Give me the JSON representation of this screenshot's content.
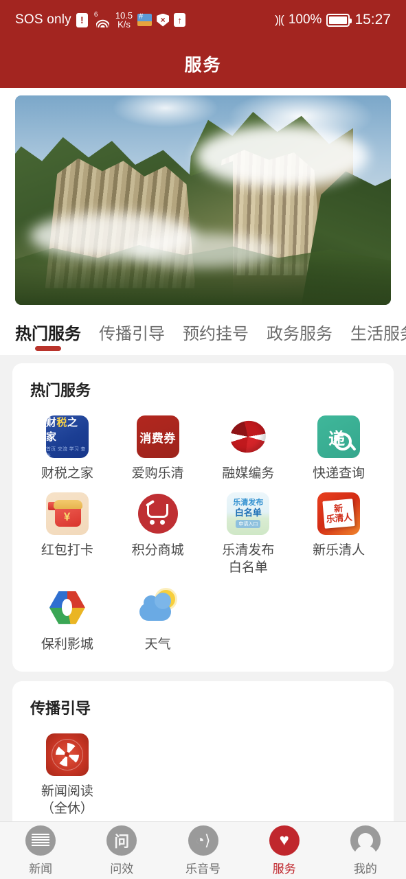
{
  "statusbar": {
    "carrier": "SOS only",
    "alert_icon": "!",
    "network_gen": "6",
    "wifi_icon": "wifi-icon",
    "speed_value": "10.5",
    "speed_unit": "K/s",
    "card_icon": "card-icon",
    "shield_icon": "×",
    "upload_icon": "↑",
    "vibrate_icon": "vibrate-icon",
    "battery_percent": "100%",
    "time": "15:27"
  },
  "header": {
    "title": "服务"
  },
  "banner": {
    "alt": "乐清山峰云雾风景横幅"
  },
  "tabs": [
    {
      "label": "热门服务",
      "active": true
    },
    {
      "label": "传播引导",
      "active": false
    },
    {
      "label": "预约挂号",
      "active": false
    },
    {
      "label": "政务服务",
      "active": false
    },
    {
      "label": "生活服务",
      "active": false
    }
  ],
  "sections": [
    {
      "title": "热门服务",
      "items": [
        {
          "name": "财税之家",
          "icon": "caishuizhijia-icon",
          "icon_text_main": "财税之家",
          "icon_text_sub": "首页 交流 学习 查账"
        },
        {
          "name": "爱购乐清",
          "icon": "xiaofeiquan-icon",
          "icon_text_main": "消费券"
        },
        {
          "name": "融媒编务",
          "icon": "rongmei-icon"
        },
        {
          "name": "快递查询",
          "icon": "express-search-icon",
          "icon_text_main": "递"
        },
        {
          "name": "红包打卡",
          "icon": "redpacket-icon",
          "icon_text_main": "¥"
        },
        {
          "name": "积分商城",
          "icon": "shopping-cart-icon"
        },
        {
          "name": "乐清发布\n白名单",
          "icon": "leqingfabu-icon",
          "icon_text_l1": "乐清发布",
          "icon_text_l2": "白名单",
          "icon_text_l3": "申请入口"
        },
        {
          "name": "新乐清人",
          "icon": "xinleqingren-icon",
          "icon_text_l1": "新",
          "icon_text_l2": "乐清人"
        },
        {
          "name": "保利影城",
          "icon": "poly-cinema-icon"
        },
        {
          "name": "天气",
          "icon": "weather-icon"
        }
      ]
    },
    {
      "title": "传播引导",
      "items": [
        {
          "name": "新闻阅读\n（全休）",
          "icon": "news-reading-icon"
        }
      ]
    }
  ],
  "tabbar": [
    {
      "label": "新闻",
      "icon": "news-icon",
      "active": false
    },
    {
      "label": "问效",
      "icon": "feedback-icon",
      "active": false
    },
    {
      "label": "乐音号",
      "icon": "audio-icon",
      "active": false
    },
    {
      "label": "服务",
      "icon": "heart-hand-icon",
      "active": true
    },
    {
      "label": "我的",
      "icon": "profile-icon",
      "active": false
    }
  ],
  "colors": {
    "brand_red": "#a32520",
    "accent_red": "#b9332b",
    "nav_active": "#c0272d",
    "page_bg": "#f2f2f2"
  }
}
